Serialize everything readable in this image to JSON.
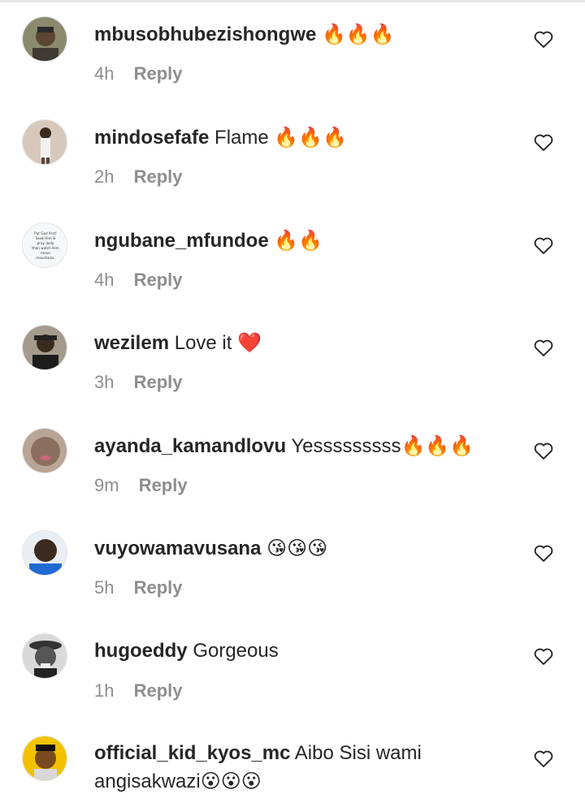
{
  "comments": [
    {
      "username": "mbusobhubezishongwe",
      "text": "",
      "emoji": "🔥🔥🔥",
      "time": "4h",
      "reply": "Reply",
      "avatar_color": "#6b6a58"
    },
    {
      "username": "mindosefafe",
      "text": "Flame",
      "emoji": "🔥🔥🔥",
      "time": "2h",
      "reply": "Reply",
      "avatar_color": "#c9b6a8"
    },
    {
      "username": "ngubane_mfundoe",
      "text": "",
      "emoji": "🔥🔥",
      "time": "4h",
      "reply": "Reply",
      "avatar_color": "#f4f8fa",
      "avatar_text": "Put God first! Seek Him & pray daily then watch Him move mountains."
    },
    {
      "username": "wezilem",
      "text": "Love it",
      "emoji": "❤️",
      "time": "3h",
      "reply": "Reply",
      "avatar_color": "#7a6a55"
    },
    {
      "username": "ayanda_kamandlovu",
      "text": "Yesssssssss",
      "emoji": "🔥🔥🔥",
      "time": "9m",
      "reply": "Reply",
      "avatar_color": "#9e8a7a"
    },
    {
      "username": "vuyowamavusana",
      "text": "",
      "emoji": "😘😘😘",
      "time": "5h",
      "reply": "Reply",
      "avatar_color": "#2a5fb0"
    },
    {
      "username": "hugoeddy",
      "text": "Gorgeous",
      "emoji": "",
      "time": "1h",
      "reply": "Reply",
      "avatar_color": "#5a5a5a"
    },
    {
      "username": "official_kid_kyos_mc",
      "text": "Aibo Sisi wami angisakwazi",
      "emoji": "😮😮😮",
      "time": "",
      "reply": "",
      "avatar_color": "#f0c400"
    }
  ],
  "colors": {
    "username": "#262626",
    "meta": "#8e8e8e",
    "fire": "#ff4500",
    "heart": "#e0245e"
  }
}
